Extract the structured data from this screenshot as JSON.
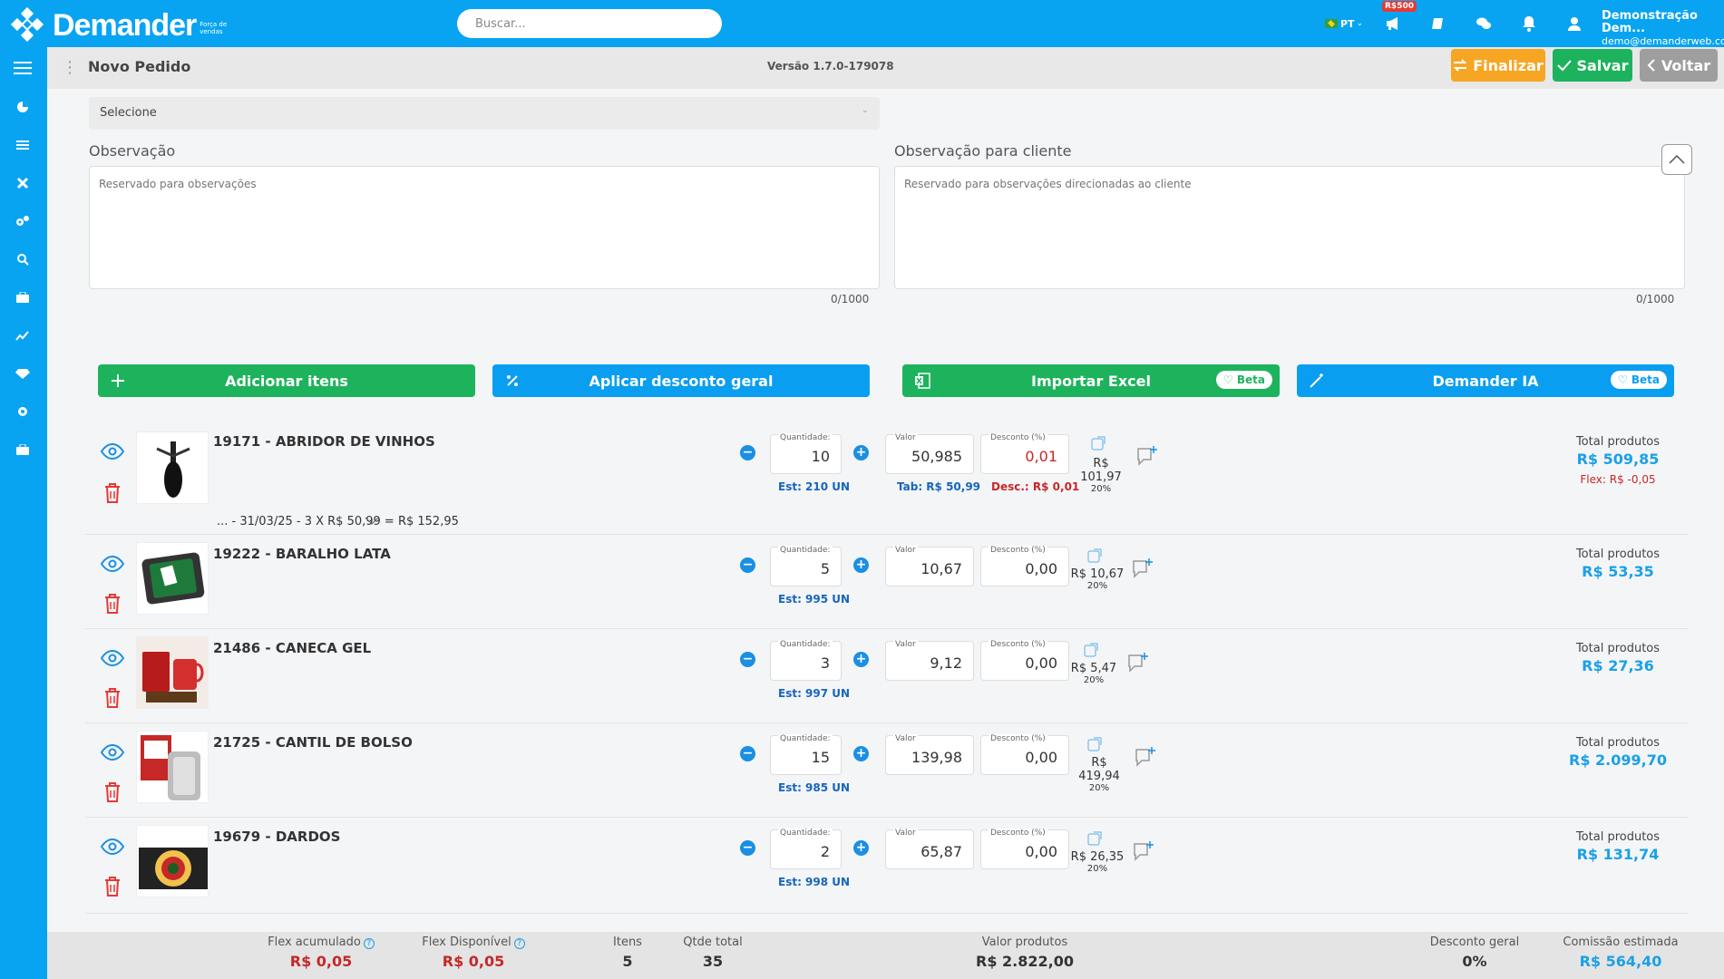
{
  "brand": {
    "name": "Demander",
    "tagline": "Força de vendas"
  },
  "search": {
    "placeholder": "Buscar..."
  },
  "topbar": {
    "language": "PT",
    "promo_badge": "R$500",
    "user_name": "Demonstração Dem...",
    "user_email": "demo@demanderweb.co..."
  },
  "page": {
    "title": "Novo Pedido",
    "version": "Versão 1.7.0-179078"
  },
  "header_buttons": {
    "finalize": "Finalizar",
    "save": "Salvar",
    "back": "Voltar"
  },
  "form": {
    "select_value": "Selecione",
    "obs_label": "Observação",
    "obs_placeholder": "Reservado para observações",
    "obs_counter": "0/1000",
    "obs_client_label": "Observação para cliente",
    "obs_client_placeholder": "Reservado para observações direcionadas ao cliente",
    "obs_client_counter": "0/1000"
  },
  "actions": {
    "add_items": "Adicionar itens",
    "apply_discount": "Aplicar desconto geral",
    "import_excel": "Importar Excel",
    "demander_ia": "Demander IA",
    "beta": "Beta"
  },
  "labels": {
    "qty": "Quantidade:",
    "value": "Valor",
    "discount": "Desconto (%)",
    "total": "Total produtos"
  },
  "items": [
    {
      "name": "19171 - ABRIDOR DE VINHOS",
      "qty": "10",
      "stock": "Est: 210 UN",
      "value": "50,985",
      "tab": "Tab: R$ 50,99",
      "discount": "0,01",
      "desc": "Desc.: R$ 0,01",
      "commission": "R$ 101,97",
      "commission_pct": "20%",
      "total": "R$ 509,85",
      "flex": "Flex: R$ -0,05",
      "history": "... - 31/03/25 - 3 X R$ 50,99 = R$ 152,95"
    },
    {
      "name": "19222 - BARALHO LATA",
      "qty": "5",
      "stock": "Est: 995 UN",
      "value": "10,67",
      "discount": "0,00",
      "commission": "R$ 10,67",
      "commission_pct": "20%",
      "total": "R$ 53,35"
    },
    {
      "name": "21486 - CANECA GEL",
      "qty": "3",
      "stock": "Est: 997 UN",
      "value": "9,12",
      "discount": "0,00",
      "commission": "R$ 5,47",
      "commission_pct": "20%",
      "total": "R$ 27,36"
    },
    {
      "name": "21725 - CANTIL DE BOLSO",
      "qty": "15",
      "stock": "Est: 985 UN",
      "value": "139,98",
      "discount": "0,00",
      "commission": "R$ 419,94",
      "commission_pct": "20%",
      "total": "R$ 2.099,70"
    },
    {
      "name": "19679 - DARDOS",
      "qty": "2",
      "stock": "Est: 998 UN",
      "value": "65,87",
      "discount": "0,00",
      "commission": "R$ 26,35",
      "commission_pct": "20%",
      "total": "R$ 131,74"
    }
  ],
  "footer": {
    "flex_acc_label": "Flex acumulado",
    "flex_acc": "R$ 0,05",
    "flex_avail_label": "Flex Disponível",
    "flex_avail": "R$ 0,05",
    "items_label": "Itens",
    "items": "5",
    "qty_label": "Qtde total",
    "qty": "35",
    "value_label": "Valor produtos",
    "value": "R$ 2.822,00",
    "discount_label": "Desconto geral",
    "discount": "0%",
    "commission_label": "Comissão estimada",
    "commission": "R$ 564,40"
  },
  "colors": {
    "primary": "#08a4f2",
    "green": "#1db35c",
    "orange": "#f6a623",
    "gray": "#9e9e9e",
    "red": "#c62828"
  }
}
